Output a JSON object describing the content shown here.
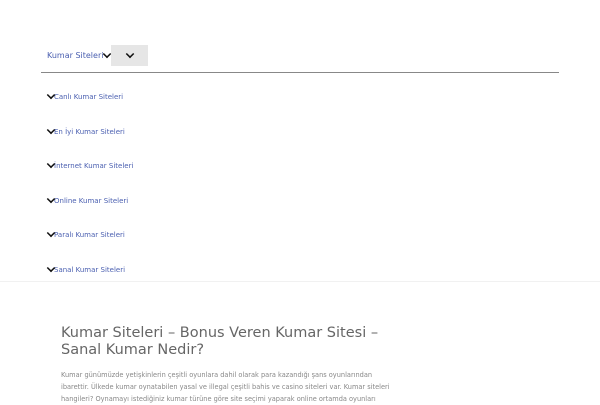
{
  "nav": {
    "top_label": "Kumar Siteleri",
    "items": [
      "Canlı Kumar Siteleri",
      "En İyi Kumar Siteleri",
      "İnternet Kumar Siteleri",
      "Online Kumar Siteleri",
      "Paralı Kumar Siteleri",
      "Sanal Kumar Siteleri"
    ]
  },
  "article": {
    "title": "Kumar Siteleri – Bonus Veren Kumar Sitesi – Sanal Kumar Nedir?",
    "body": "Kumar günümüzde yetişkinlerin çeşitli oyunlara dahil olarak para kazandığı şans oyunlarından ibarettir. Ülkede kumar oynatabilen yasal ve illegal çeşitli bahis ve casino siteleri var. Kumar siteleri hangileri? Oynamayı istediğiniz kumar türüne göre site seçimi yaparak online ortamda oyunları"
  }
}
